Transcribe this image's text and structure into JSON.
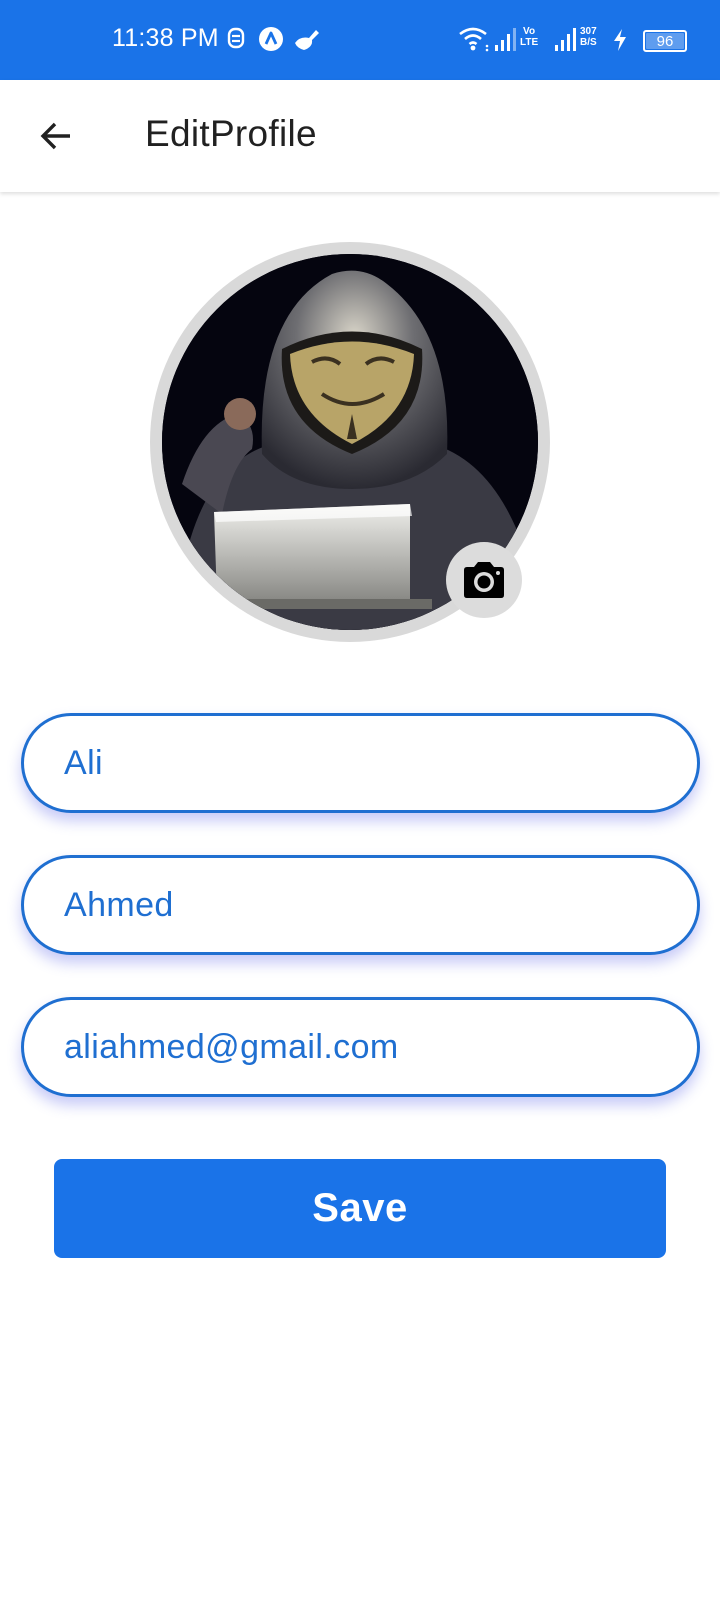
{
  "status_bar": {
    "time": "11:38 PM",
    "left_icons": [
      "notification-app-icon",
      "app-a-icon",
      "cleaner-icon"
    ],
    "volte_top": "Vo",
    "volte_bottom": "LTE",
    "net_speed_value": "307",
    "net_speed_unit": "B/S",
    "battery_level": "96",
    "background": "#1a73e8"
  },
  "app_bar": {
    "title": "EditProfile",
    "back_icon": "arrow-left-icon"
  },
  "profile": {
    "avatar_image": "hooded-masked-person-photo",
    "camera_icon": "camera-icon"
  },
  "form": {
    "first_name": "Ali",
    "last_name": "Ahmed",
    "email": "aliahmed@gmail.com",
    "accent": "#1f6fd1"
  },
  "save_button": {
    "label": "Save",
    "color": "#1a73e8"
  }
}
